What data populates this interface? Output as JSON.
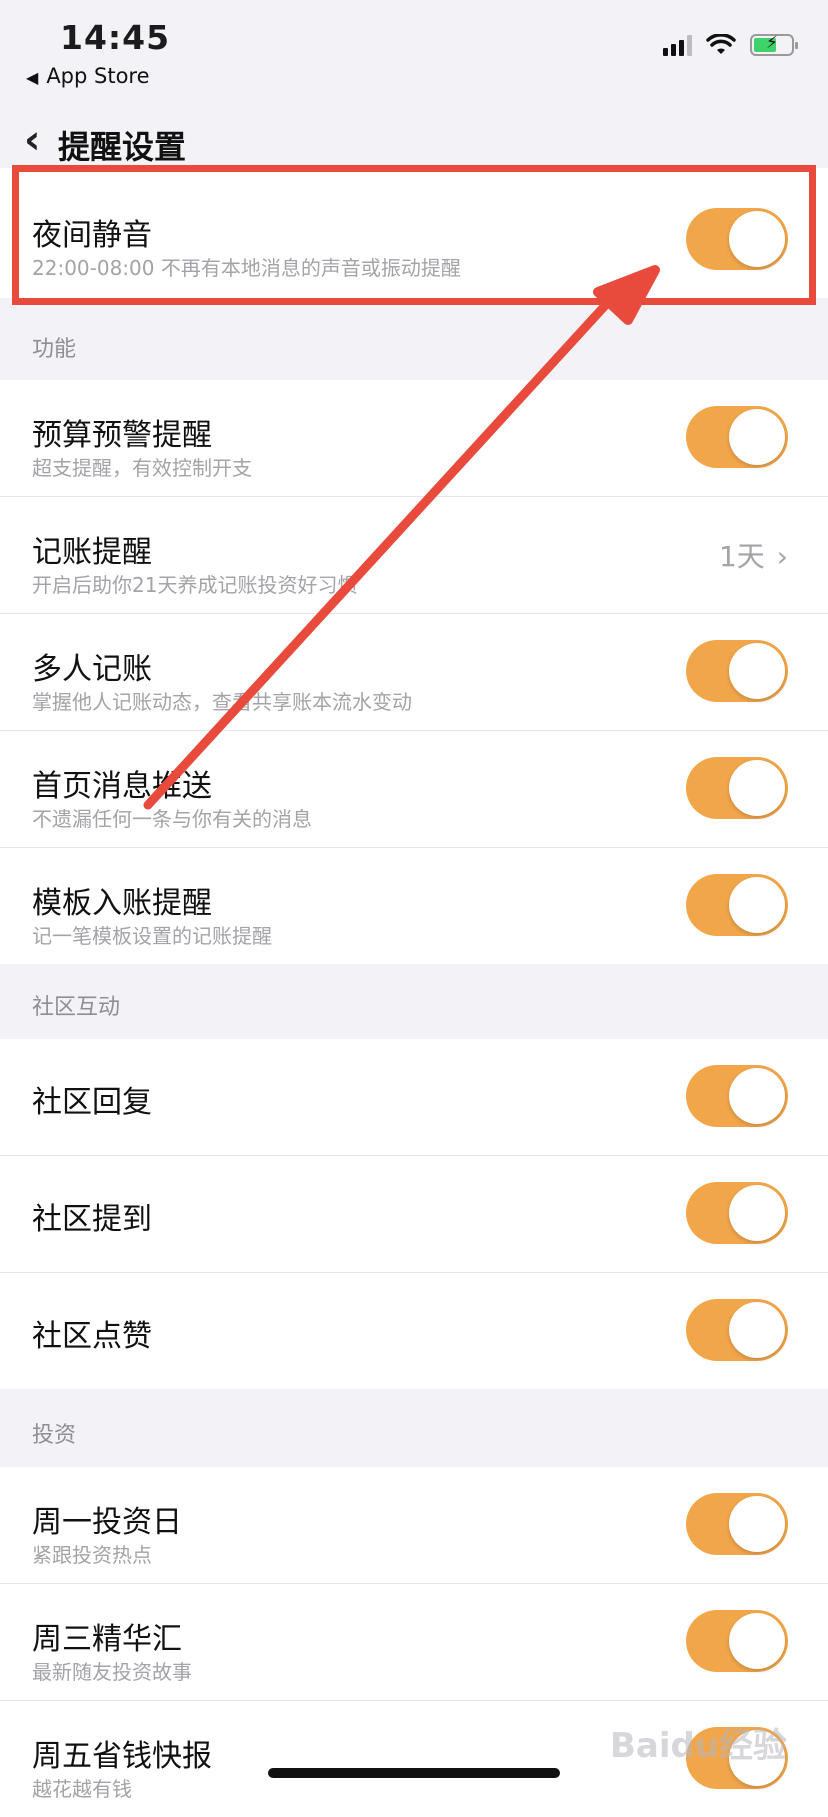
{
  "status": {
    "time": "14:45",
    "back_app": "App Store"
  },
  "nav": {
    "title": "提醒设置"
  },
  "night_mute": {
    "label": "夜间静音",
    "sub": "22:00-08:00 不再有本地消息的声音或振动提醒",
    "on": true
  },
  "sections": {
    "features": {
      "header": "功能",
      "items": [
        {
          "label": "预算预警提醒",
          "sub": "超支提醒，有效控制开支",
          "on": true
        },
        {
          "label": "记账提醒",
          "sub": "开启后助你21天养成记账投资好习惯",
          "value": "1天"
        },
        {
          "label": "多人记账",
          "sub": "掌握他人记账动态，查看共享账本流水变动",
          "on": true
        },
        {
          "label": "首页消息推送",
          "sub": "不遗漏任何一条与你有关的消息",
          "on": true
        },
        {
          "label": "模板入账提醒",
          "sub": "记一笔模板设置的记账提醒",
          "on": true
        }
      ]
    },
    "community": {
      "header": "社区互动",
      "items": [
        {
          "label": "社区回复",
          "on": true
        },
        {
          "label": "社区提到",
          "on": true
        },
        {
          "label": "社区点赞",
          "on": true
        }
      ]
    },
    "invest": {
      "header": "投资",
      "items": [
        {
          "label": "周一投资日",
          "sub": "紧跟投资热点",
          "on": true
        },
        {
          "label": "周三精华汇",
          "sub": "最新随友投资故事",
          "on": true
        },
        {
          "label": "周五省钱快报",
          "sub": "越花越有钱",
          "on": true
        }
      ]
    }
  },
  "colors": {
    "accent": "#f2a64a",
    "highlight": "#e84a3c",
    "background": "#f2f2f7"
  },
  "watermark": "Baidu经验"
}
